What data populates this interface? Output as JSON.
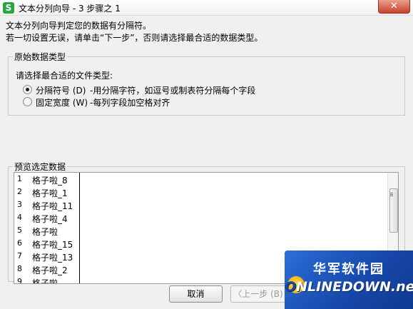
{
  "window": {
    "title": "文本分列向导 - 3 步骤之 1",
    "app_icon": "S",
    "close_symbol": "✕"
  },
  "description": {
    "line1": "文本分列向导判定您的数据有分隔符。",
    "line2": "若一切设置无误，请单击“下一步”，否则请选择最合适的数据类型。"
  },
  "original_type": {
    "legend": "原始数据类型",
    "prompt": "请选择最合适的文件类型:",
    "options": [
      {
        "label": "分隔符号 (D)",
        "desc": "-用分隔字符，如逗号或制表符分隔每个字段",
        "checked": true
      },
      {
        "label": "固定宽度 (W)",
        "desc": "-每列字段加空格对齐",
        "checked": false
      }
    ]
  },
  "preview": {
    "legend": "预览选定数据",
    "rows": [
      {
        "num": "1",
        "text": "格子啦_8"
      },
      {
        "num": "2",
        "text": "格子啦_1"
      },
      {
        "num": "3",
        "text": "格子啦_11"
      },
      {
        "num": "4",
        "text": "格子啦_4"
      },
      {
        "num": "5",
        "text": "格子啦"
      },
      {
        "num": "6",
        "text": "格子啦_15"
      },
      {
        "num": "7",
        "text": "格子啦_13"
      },
      {
        "num": "8",
        "text": "格子啦_2"
      },
      {
        "num": "9",
        "text": "格子啦"
      }
    ]
  },
  "buttons": {
    "cancel": "取消",
    "back": "〈上一步 (B)"
  },
  "watermark": {
    "line1": "华军软件园",
    "line2": "NLINEDOWN.net",
    "o_letter": "O"
  }
}
